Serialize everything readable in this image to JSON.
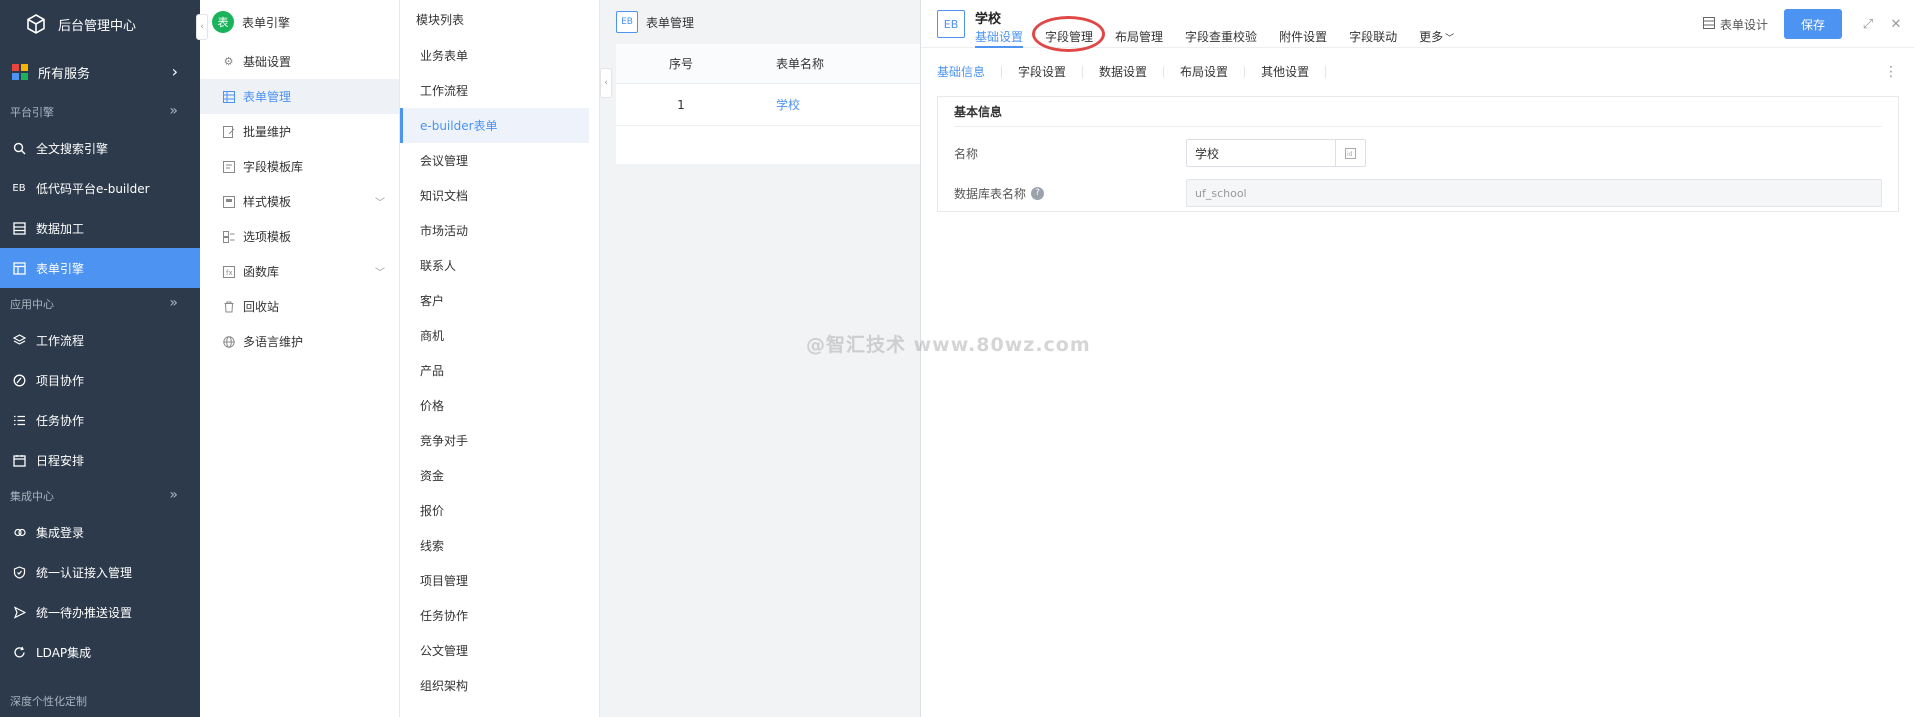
{
  "sidebar": {
    "title": "后台管理中心",
    "all_services": "所有服务",
    "sections": {
      "platform": "平台引擎",
      "app_center": "应用中心",
      "integration": "集成中心",
      "custom": "深度个性化定制"
    },
    "platform_items": [
      {
        "label": "全文搜索引擎",
        "icon": "search-icon"
      },
      {
        "label": "低代码平台e-builder",
        "icon": "eb-icon"
      },
      {
        "label": "数据加工",
        "icon": "data-icon"
      },
      {
        "label": "表单引擎",
        "icon": "form-icon"
      }
    ],
    "app_items": [
      {
        "label": "工作流程",
        "icon": "layers-icon"
      },
      {
        "label": "项目协作",
        "icon": "project-icon"
      },
      {
        "label": "任务协作",
        "icon": "list-icon"
      },
      {
        "label": "日程安排",
        "icon": "calendar-icon"
      }
    ],
    "integration_items": [
      {
        "label": "集成登录",
        "icon": "login-icon"
      },
      {
        "label": "统一认证接入管理",
        "icon": "shield-icon"
      },
      {
        "label": "统一待办推送设置",
        "icon": "send-icon"
      },
      {
        "label": "LDAP集成",
        "icon": "sync-icon"
      }
    ],
    "active_color": "#4c93f2"
  },
  "panel2": {
    "header": "表单引擎",
    "header_icon": "表",
    "items": [
      {
        "label": "基础设置",
        "icon": "gear-icon"
      },
      {
        "label": "表单管理",
        "icon": "table-icon"
      },
      {
        "label": "批量维护",
        "icon": "edit-icon"
      },
      {
        "label": "字段模板库",
        "icon": "template-icon"
      },
      {
        "label": "样式模板",
        "icon": "style-icon"
      },
      {
        "label": "选项模板",
        "icon": "option-icon"
      },
      {
        "label": "函数库",
        "icon": "function-icon"
      },
      {
        "label": "回收站",
        "icon": "trash-icon"
      },
      {
        "label": "多语言维护",
        "icon": "globe-icon"
      }
    ]
  },
  "panel3": {
    "title": "模块列表",
    "items": [
      "业务表单",
      "工作流程",
      "e-builder表单",
      "会议管理",
      "知识文档",
      "市场活动",
      "联系人",
      "客户",
      "商机",
      "产品",
      "价格",
      "竞争对手",
      "资金",
      "报价",
      "线索",
      "项目管理",
      "任务协作",
      "公文管理",
      "组织架构"
    ]
  },
  "panel4": {
    "badge": "EB",
    "title": "表单管理",
    "columns": [
      "序号",
      "表单名称"
    ],
    "rows": [
      {
        "index": "1",
        "name": "学校"
      }
    ]
  },
  "detail": {
    "badge": "EB",
    "title": "学校",
    "tabs": [
      "基础设置",
      "字段管理",
      "布局管理",
      "字段查重校验",
      "附件设置",
      "字段联动",
      "更多"
    ],
    "design_label": "表单设计",
    "save_label": "保存",
    "subtabs": [
      "基础信息",
      "字段设置",
      "数据设置",
      "布局设置",
      "其他设置"
    ],
    "card_title": "基本信息",
    "name_label": "名称",
    "name_value": "学校",
    "db_label": "数据库表名称",
    "db_value": "uf_school"
  },
  "watermark": "@智汇技术 www.80wz.com"
}
